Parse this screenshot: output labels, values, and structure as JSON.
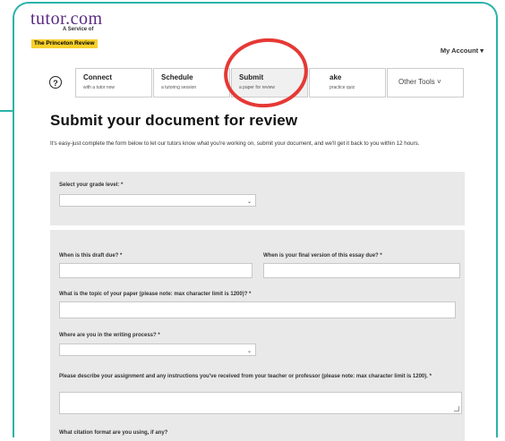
{
  "brand": {
    "name": "tutor.com",
    "tagline": "A Service of",
    "partner": "The Princeton Review"
  },
  "header": {
    "account_label": "My Account ▾"
  },
  "nav": {
    "help_label": "?",
    "tabs": [
      {
        "title": "Connect",
        "subtitle": "with a tutor now"
      },
      {
        "title": "Schedule",
        "subtitle": "a tutoring session"
      },
      {
        "title": "Submit",
        "subtitle": "a paper for review"
      },
      {
        "title": "ake",
        "subtitle": "practice quiz"
      },
      {
        "title": "Other Tools ˅"
      }
    ]
  },
  "main": {
    "title": "Submit your document for review",
    "intro": "It's easy-just complete the form below to let our tutors know what you're working on, submit your document, and we'll get it back to you within 12 hours."
  },
  "form": {
    "grade_label": "Select your grade level: *",
    "grade_value": "",
    "draft_due_label": "When is this draft due? *",
    "draft_due_value": "",
    "final_due_label": "When is your final version of this essay due? *",
    "final_due_value": "",
    "topic_label": "What is the topic of your paper (please note: max character limit is 1200)? *",
    "topic_value": "",
    "process_label": "Where are you in the writing process? *",
    "process_value": "",
    "assignment_label": "Please describe your assignment and any instructions you've received from your teacher or professor (please note: max character limit is 1200). *",
    "assignment_value": "",
    "citation_label": "What citation format are you using, if any?"
  },
  "colors": {
    "frame": "#2bb3a8",
    "highlight": "#e53935",
    "brand": "#5a2a82",
    "panel": "#e9e9e9"
  }
}
